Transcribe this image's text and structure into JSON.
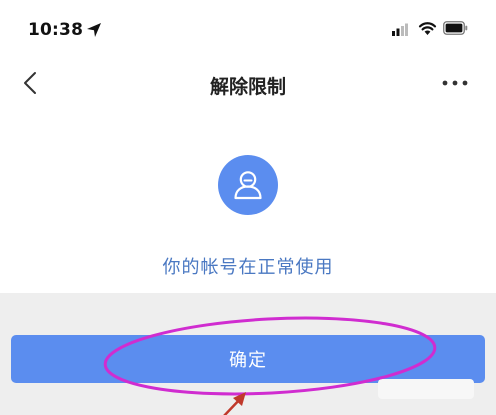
{
  "status_bar": {
    "time": "10:38",
    "icons": [
      "location-arrow-icon",
      "signal-icon",
      "wifi-icon",
      "battery-icon"
    ]
  },
  "nav": {
    "title": "解除限制",
    "back_icon": "chevron-left-icon",
    "more_icon": "more-dots-icon"
  },
  "content": {
    "avatar_icon": "user-avatar-icon",
    "status_message": "你的帐号在正常使用"
  },
  "actions": {
    "confirm_label": "确定"
  },
  "colors": {
    "accent_blue": "#5b8def",
    "status_text": "#4a78c2",
    "annotation_ellipse": "#d02cd0",
    "annotation_arrow": "#c0392b"
  }
}
